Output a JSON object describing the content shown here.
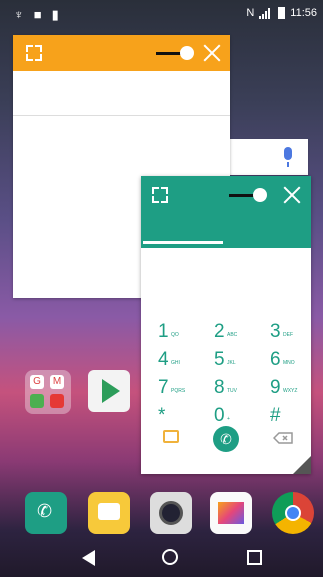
{
  "status": {
    "time": "11:56",
    "carrier_indicator": "N"
  },
  "dialer": {
    "keys": [
      [
        {
          "digit": "1",
          "letters": "QO"
        },
        {
          "digit": "2",
          "letters": "ABC"
        },
        {
          "digit": "3",
          "letters": "DEF"
        }
      ],
      [
        {
          "digit": "4",
          "letters": "GHI"
        },
        {
          "digit": "5",
          "letters": "JKL"
        },
        {
          "digit": "6",
          "letters": "MNO"
        }
      ],
      [
        {
          "digit": "7",
          "letters": "PQRS"
        },
        {
          "digit": "8",
          "letters": "TUV"
        },
        {
          "digit": "9",
          "letters": "WXYZ"
        }
      ],
      [
        {
          "digit": "*",
          "letters": ""
        },
        {
          "digit": "0",
          "letters": "+"
        },
        {
          "digit": "#",
          "letters": ""
        }
      ]
    ]
  },
  "colors": {
    "window1_accent": "#f7a21b",
    "dialer_accent": "#1e9e84"
  },
  "folder": {
    "labels": [
      "G",
      "M"
    ]
  }
}
